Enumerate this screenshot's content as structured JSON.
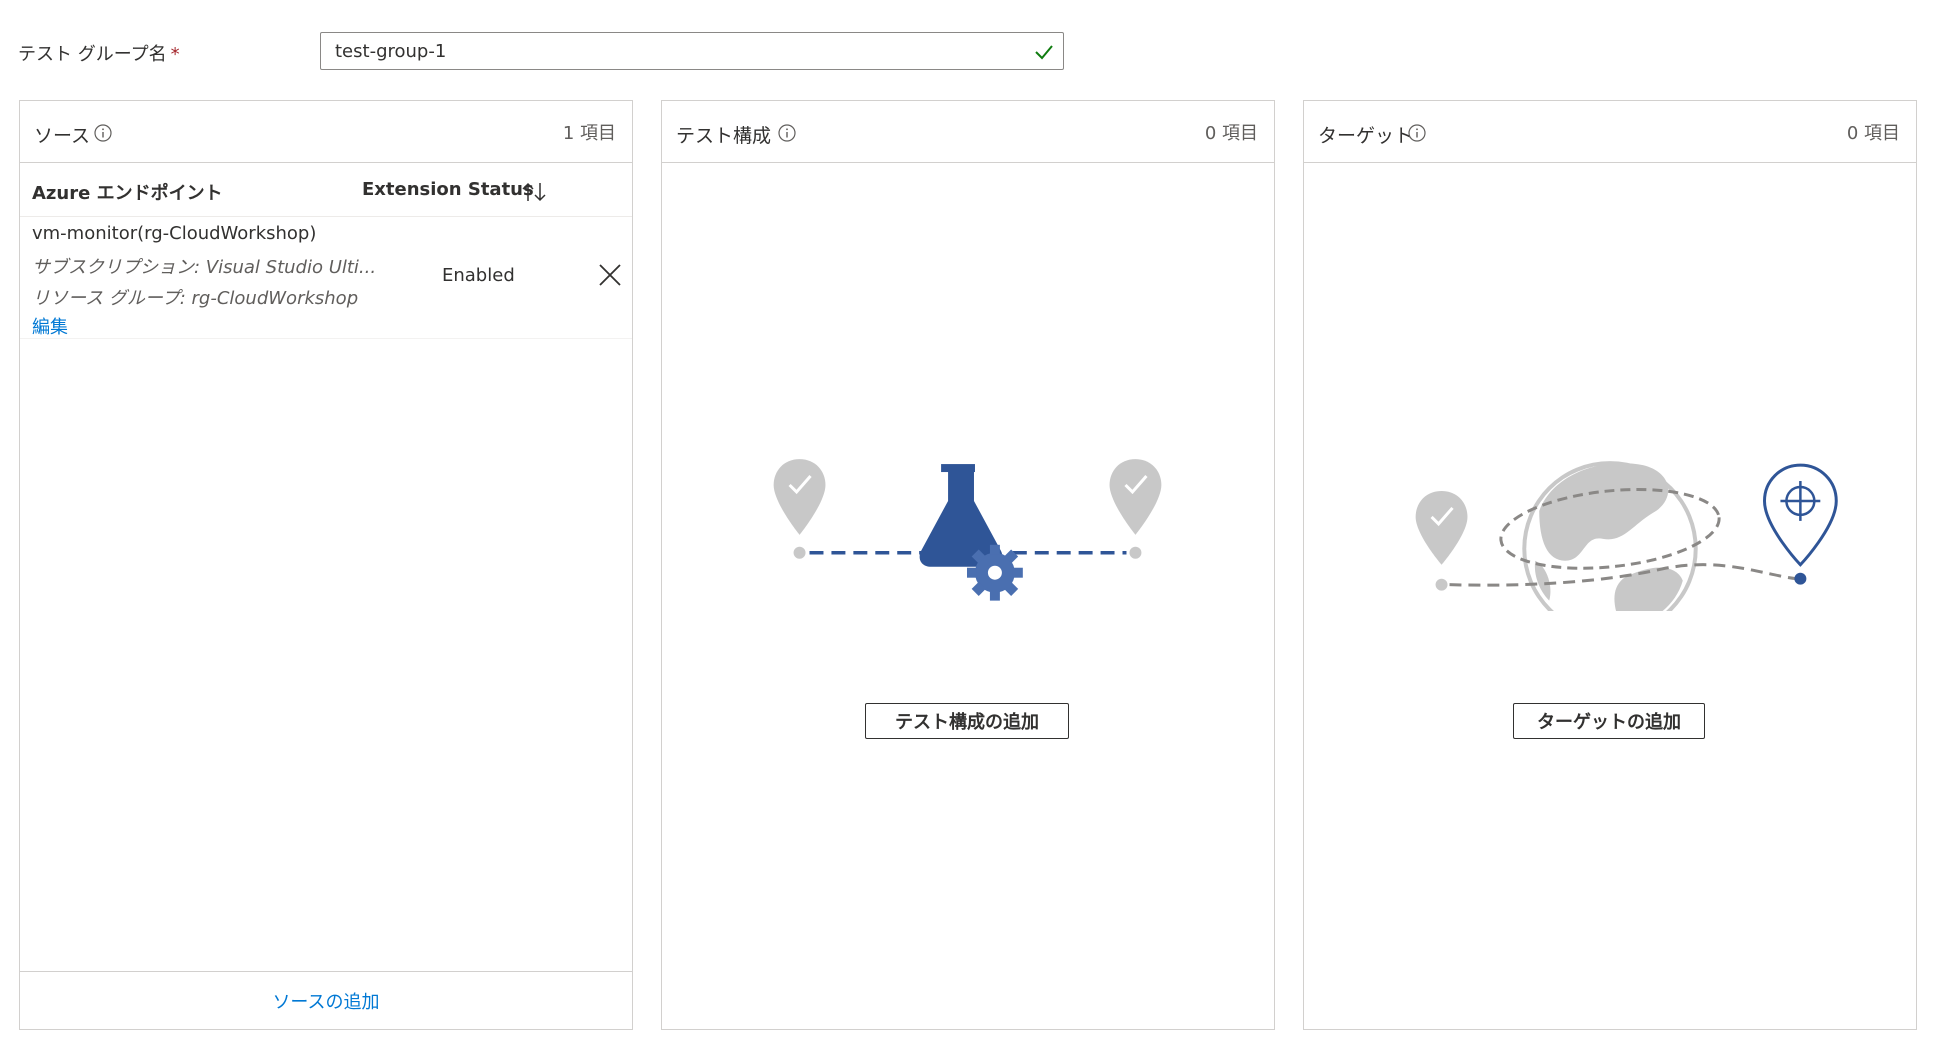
{
  "test_group": {
    "label": "テスト グループ名",
    "required_mark": "*",
    "value": "test-group-1"
  },
  "source_panel": {
    "title": "ソース",
    "count": "1 項目",
    "columns": [
      "Azure エンドポイント",
      "Extension Status"
    ],
    "rows": [
      {
        "name": "vm-monitor(rg-CloudWorkshop)",
        "subscription": "サブスクリプション: Visual Studio Ulti...",
        "resource_group": "リソース グループ: rg-CloudWorkshop",
        "edit": "編集",
        "status": "Enabled"
      }
    ],
    "add_link": "ソースの追加"
  },
  "config_panel": {
    "title": "テスト構成",
    "count": "0 項目",
    "add_button": "テスト構成の追加"
  },
  "target_panel": {
    "title": "ターゲット",
    "count": "0 項目",
    "add_button": "ターゲットの追加"
  },
  "colors": {
    "accent": "#0078d4",
    "illustration_blue": "#2f5597",
    "illustration_grey": "#c8c8c8",
    "valid_green": "#107c10"
  }
}
